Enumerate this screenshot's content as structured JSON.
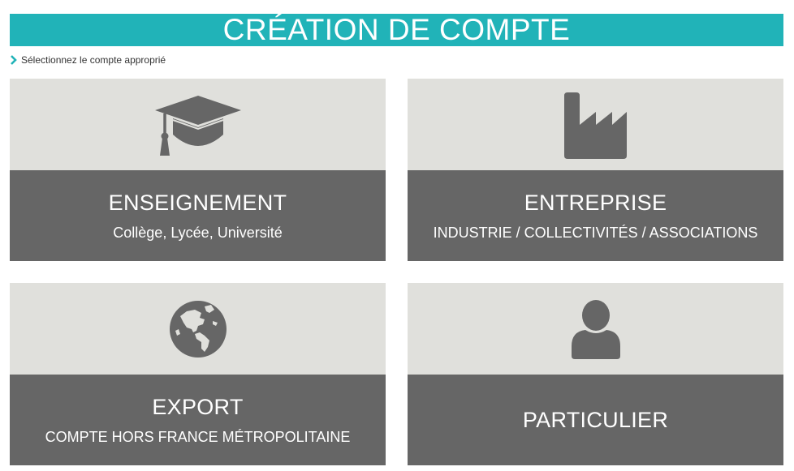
{
  "header": {
    "title": "CRÉATION DE COMPTE"
  },
  "hint": {
    "text": "Sélectionnez le compte approprié"
  },
  "cards": [
    {
      "title": "ENSEIGNEMENT",
      "subtitle": "Collège, Lycée, Université",
      "icon": "graduation-cap-icon"
    },
    {
      "title": "ENTREPRISE",
      "subtitle": "INDUSTRIE / COLLECTIVITÉS / ASSOCIATIONS",
      "icon": "factory-icon"
    },
    {
      "title": "EXPORT",
      "subtitle": "COMPTE HORS FRANCE MÉTROPOLITAINE",
      "icon": "globe-icon"
    },
    {
      "title": "PARTICULIER",
      "subtitle": "",
      "icon": "user-icon"
    }
  ],
  "colors": {
    "accent": "#21b3b8",
    "card_top": "#e0e0dc",
    "card_bottom": "#666666",
    "icon": "#666666"
  }
}
